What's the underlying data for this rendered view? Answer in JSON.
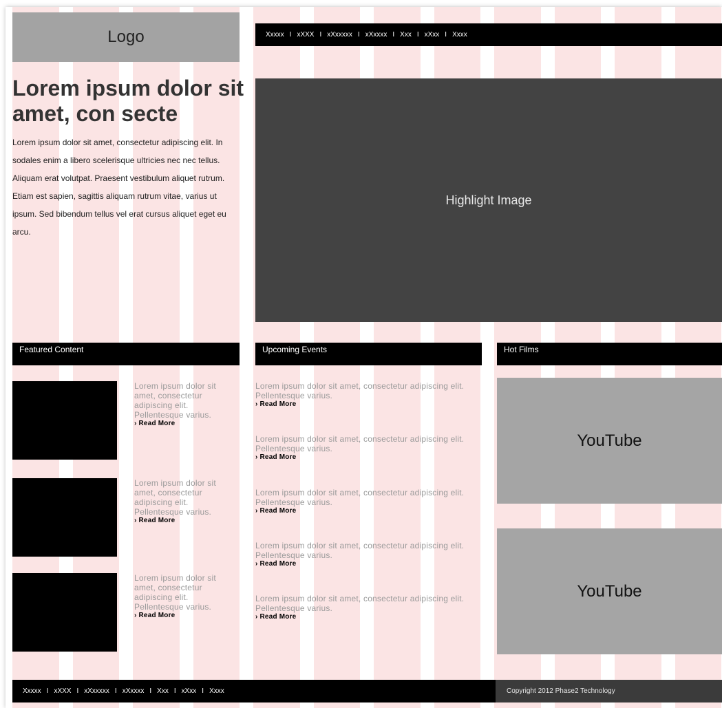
{
  "logo": {
    "label": "Logo"
  },
  "intro": {
    "headline": "Lorem ipsum dolor sit amet, con secte",
    "body": "Lorem ipsum dolor sit amet, consectetur adipiscing elit. In sodales enim a libero scelerisque ultricies nec nec tellus. Aliquam erat volutpat. Praesent vestibulum aliquet rutrum. Etiam est sapien, sagittis aliquam rutrum vitae, varius ut ipsum. Sed bibendum tellus vel erat cursus aliquet eget eu arcu."
  },
  "nav": {
    "items": [
      "Xxxxx",
      "xXXX",
      "xXxxxxx",
      "xXxxxx",
      "Xxx",
      "xXxx",
      "Xxxx"
    ],
    "separator": "I"
  },
  "highlight": {
    "label": "Highlight Image"
  },
  "featured": {
    "title": "Featured Content",
    "items": [
      {
        "text": "Lorem ipsum dolor sit amet, consectetur adipiscing elit. Pellentesque varius.",
        "link": "› Read More"
      },
      {
        "text": "Lorem ipsum dolor sit amet, consectetur adipiscing elit. Pellentesque varius.",
        "link": "› Read More"
      },
      {
        "text": "Lorem ipsum dolor sit amet, consectetur adipiscing elit. Pellentesque varius.",
        "link": "› Read More"
      }
    ]
  },
  "events": {
    "title": "Upcoming Events",
    "items": [
      {
        "text": "Lorem ipsum dolor sit amet, consectetur adipiscing elit. Pellentesque varius.",
        "link": "› Read More"
      },
      {
        "text": "Lorem ipsum dolor sit amet, consectetur adipiscing elit. Pellentesque varius.",
        "link": "› Read More"
      },
      {
        "text": "Lorem ipsum dolor sit amet, consectetur adipiscing elit. Pellentesque varius.",
        "link": "› Read More"
      },
      {
        "text": "Lorem ipsum dolor sit amet, consectetur adipiscing elit. Pellentesque varius.",
        "link": "› Read More"
      },
      {
        "text": "Lorem ipsum dolor sit amet, consectetur adipiscing elit. Pellentesque varius.",
        "link": "› Read More"
      }
    ]
  },
  "films": {
    "title": "Hot Films",
    "videos": [
      "YouTube",
      "YouTube"
    ]
  },
  "footer": {
    "nav_items": [
      "Xxxxx",
      "xXXX",
      "xXxxxxx",
      "xXxxxx",
      "Xxx",
      "xXxx",
      "Xxxx"
    ],
    "separator": "I",
    "copyright": "Copyright 2012 Phase2 Technology"
  },
  "colors": {
    "grid_column": "#fbe4e4",
    "header_bar": "#000000",
    "highlight_bg": "#434343",
    "placeholder_gray": "#a5a5a5",
    "muted_text": "#9a9a9a"
  }
}
